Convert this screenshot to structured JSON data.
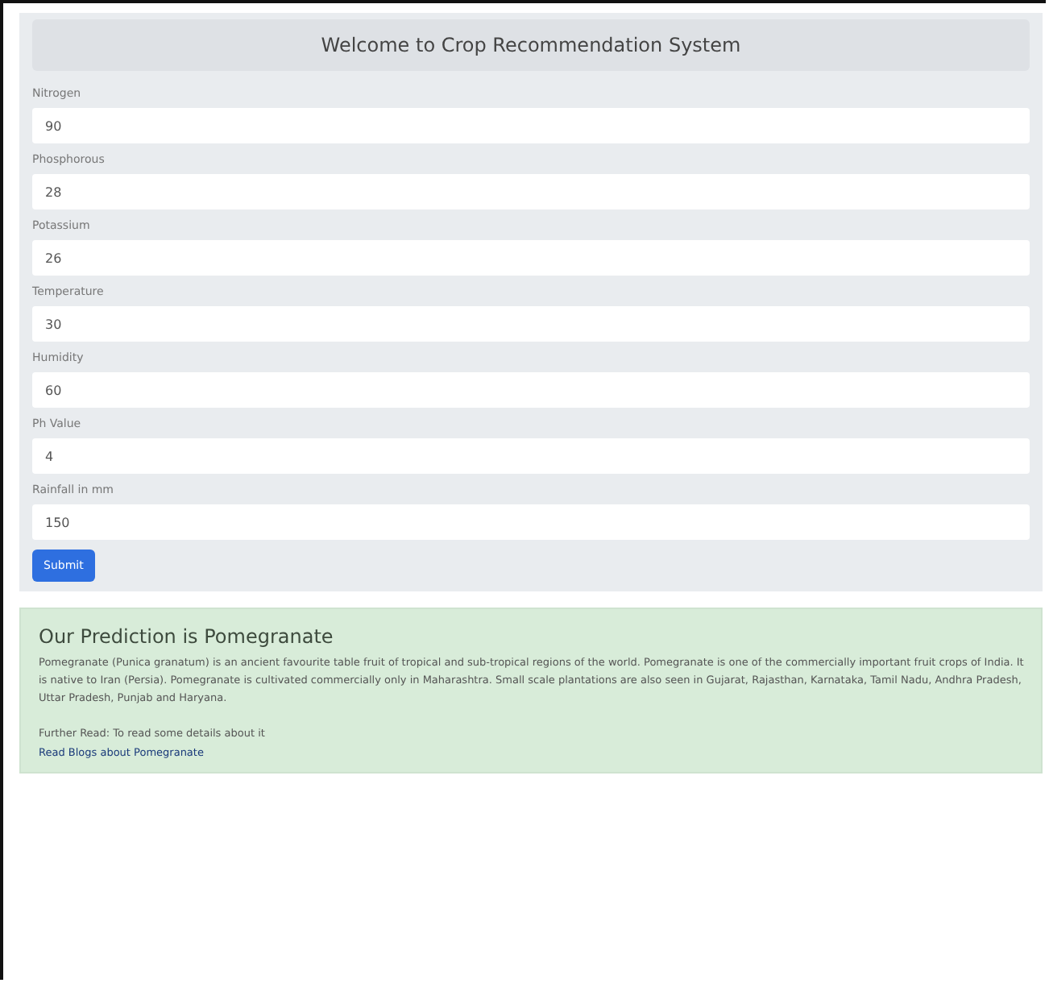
{
  "form": {
    "title": "Welcome to Crop Recommendation System",
    "fields": [
      {
        "label": "Nitrogen",
        "value": "90"
      },
      {
        "label": "Phosphorous",
        "value": "28"
      },
      {
        "label": "Potassium",
        "value": "26"
      },
      {
        "label": "Temperature",
        "value": "30"
      },
      {
        "label": "Humidity",
        "value": "60"
      },
      {
        "label": "Ph Value",
        "value": "4"
      },
      {
        "label": "Rainfall in mm",
        "value": "150"
      }
    ],
    "submit": "Submit"
  },
  "result": {
    "title": "Our Prediction is Pomegranate",
    "description": "Pomegranate (Punica granatum) is an ancient favourite table fruit of tropical and sub-tropical regions of the world. Pomegranate is one of the commercially important fruit crops of India. It is native to Iran (Persia). Pomegranate is cultivated commercially only in Maharashtra. Small scale plantations are also seen in Gujarat, Rajasthan, Karnataka, Tamil Nadu, Andhra Pradesh, Uttar Pradesh, Punjab and Haryana.",
    "further": "Further Read: To read some details about it",
    "link": "Read Blogs about Pomegranate"
  }
}
